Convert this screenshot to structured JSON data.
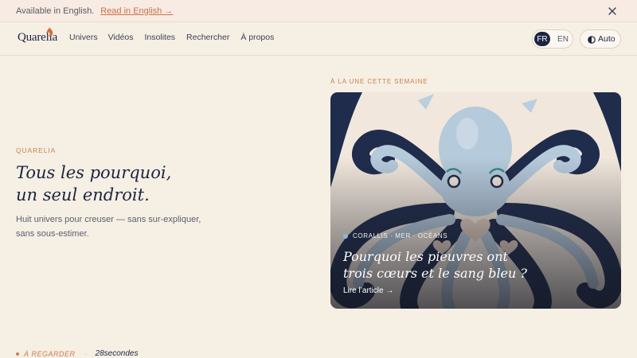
{
  "banner": {
    "text": "Available in English.",
    "link": "Read in English →"
  },
  "nav": {
    "logo": "Quarelia",
    "links": [
      "Univers",
      "Vidéos",
      "Insolites",
      "Rechercher",
      "À propos"
    ],
    "lang_active": "FR",
    "lang_other": "EN",
    "theme_label": "Auto"
  },
  "hero": {
    "eyebrow": "QUARELIA",
    "headline_line1": "Tous les pourquoi,",
    "headline_line2": "un seul endroit.",
    "sub_line1": "Huit univers pour creuser — sans sur-expliquer,",
    "sub_line2": "sans sous-estimer."
  },
  "featured": {
    "label": "À LA UNE CETTE SEMAINE",
    "meta": "CORALLIS · MER · OCÉANS",
    "title_line1": "Pourquoi les pieuvres ont",
    "title_line2": "trois cœurs et le sang bleu ?",
    "cta": "Lire l’article →"
  },
  "bottom": {
    "watch": "À REGARDER",
    "separator": "·",
    "channel": "28secondes"
  },
  "colors": {
    "background": "#f6efe4",
    "accent": "#c8814f",
    "navy": "#1c2540"
  }
}
